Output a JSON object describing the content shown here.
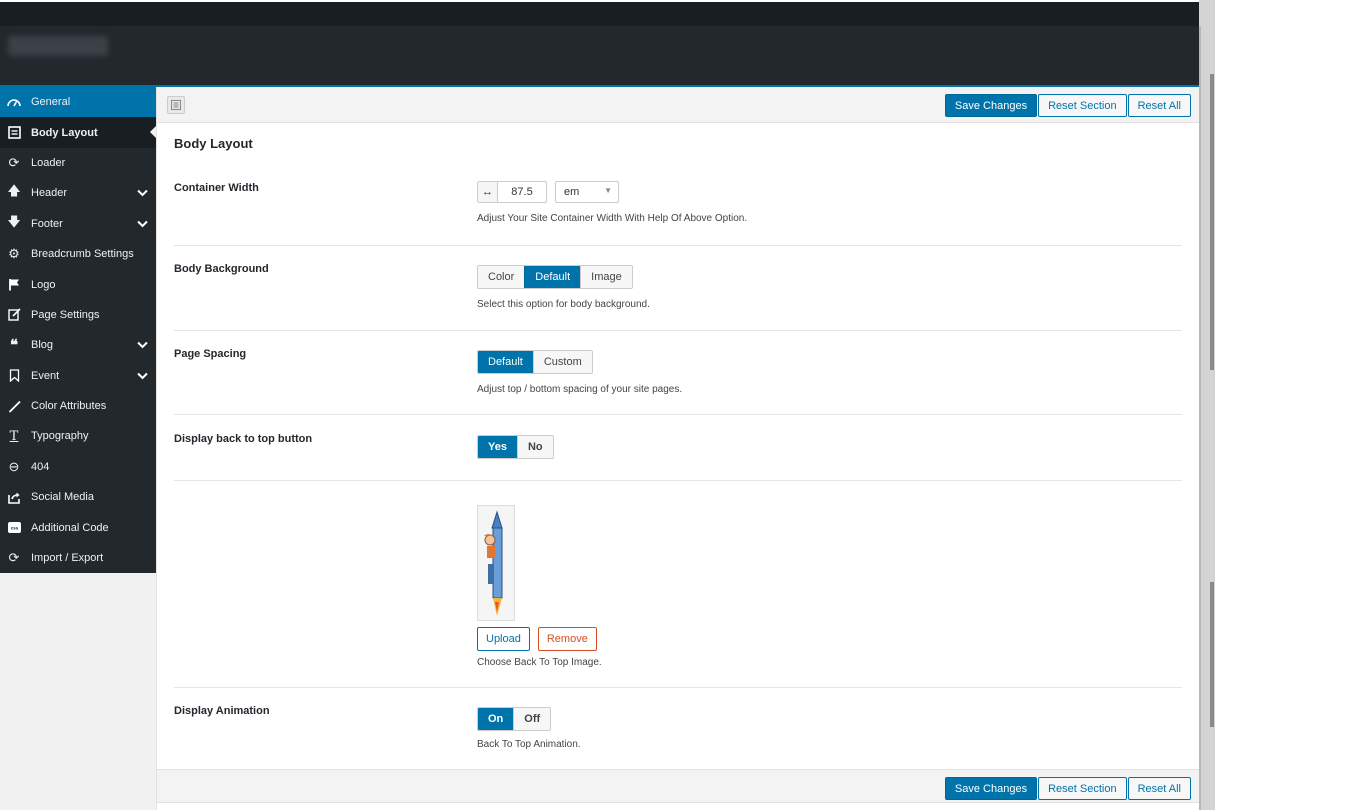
{
  "sidebar": {
    "items": [
      {
        "label": "General",
        "icon": "dashboard-icon"
      },
      {
        "label": "Body Layout",
        "icon": "layout-icon"
      },
      {
        "label": "Loader",
        "icon": "refresh-icon"
      },
      {
        "label": "Header",
        "icon": "arrow-up-icon"
      },
      {
        "label": "Footer",
        "icon": "arrow-down-icon"
      },
      {
        "label": "Breadcrumb Settings",
        "icon": "gear-icon"
      },
      {
        "label": "Logo",
        "icon": "flag-icon"
      },
      {
        "label": "Page Settings",
        "icon": "edit-icon"
      },
      {
        "label": "Blog",
        "icon": "quote-icon"
      },
      {
        "label": "Event",
        "icon": "bookmark-icon"
      },
      {
        "label": "Color Attributes",
        "icon": "brush-icon"
      },
      {
        "label": "Typography",
        "icon": "text-icon"
      },
      {
        "label": "404",
        "icon": "minus-circle-icon"
      },
      {
        "label": "Social Media",
        "icon": "share-icon"
      },
      {
        "label": "Additional Code",
        "icon": "css-icon"
      },
      {
        "label": "Import / Export",
        "icon": "sync-icon"
      }
    ]
  },
  "toolbar": {
    "save_label": "Save Changes",
    "reset_section_label": "Reset Section",
    "reset_all_label": "Reset All"
  },
  "section": {
    "title": "Body Layout"
  },
  "fields": {
    "container_width": {
      "label": "Container Width",
      "value": "87.5",
      "unit": "em",
      "desc": "Adjust Your Site Container Width With Help Of Above Option."
    },
    "body_background": {
      "label": "Body Background",
      "options": [
        "Color",
        "Default",
        "Image"
      ],
      "selected": "Default",
      "desc": "Select this option for body background."
    },
    "page_spacing": {
      "label": "Page Spacing",
      "options": [
        "Default",
        "Custom"
      ],
      "selected": "Default",
      "desc": "Adjust top / bottom spacing of your site pages."
    },
    "back_to_top": {
      "label": "Display back to top button",
      "options": [
        "Yes",
        "No"
      ],
      "selected": "Yes"
    },
    "back_to_top_image": {
      "upload_label": "Upload",
      "remove_label": "Remove",
      "desc": "Choose Back To Top Image."
    },
    "display_animation": {
      "label": "Display Animation",
      "options": [
        "On",
        "Off"
      ],
      "selected": "On",
      "desc": "Back To Top Animation."
    }
  },
  "colors": {
    "accent": "#0073aa",
    "sidebar_bg": "#23282d",
    "danger": "#d54e21"
  }
}
